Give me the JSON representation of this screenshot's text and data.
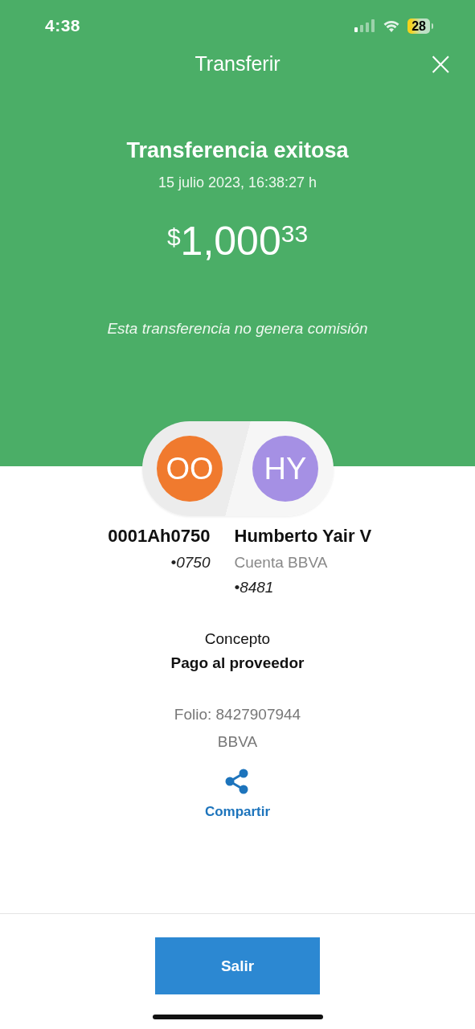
{
  "status_bar": {
    "time": "4:38",
    "battery": "28"
  },
  "header": {
    "title": "Transferir",
    "close": "×"
  },
  "summary": {
    "title": "Transferencia exitosa",
    "date": "15 julio 2023, 16:38:27 h",
    "amount": {
      "currency": "$",
      "integer": "1,000",
      "cents": "33"
    },
    "note": "Esta transferencia no genera comisión"
  },
  "parties": [
    {
      "initials": "OO",
      "color": "#f07a2e",
      "name": "0001Ah0750",
      "lines": [
        {
          "kind": "account",
          "text": "•0750"
        }
      ]
    },
    {
      "initials": "HY",
      "color": "#a590e4",
      "name": "Humberto Yair V",
      "lines": [
        {
          "kind": "bank",
          "text": "Cuenta BBVA"
        },
        {
          "kind": "account",
          "text": "•8481"
        }
      ]
    }
  ],
  "concept": {
    "label": "Concepto",
    "value": "Pago al proveedor"
  },
  "folio": {
    "text": "Folio: 8427907944",
    "bank": "BBVA"
  },
  "share": {
    "label": "Compartir"
  },
  "footer": {
    "button": "Salir"
  }
}
